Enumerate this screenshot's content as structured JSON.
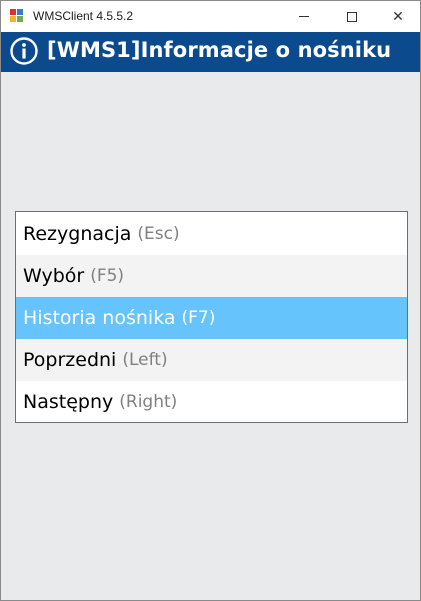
{
  "window": {
    "title": "WMSClient 4.5.5.2",
    "controls": {
      "minimize": "minimize",
      "maximize": "maximize",
      "close": "✕"
    }
  },
  "header": {
    "icon": "info-icon",
    "title": "[WMS1]Informacje o nośniku",
    "background": "#0c4a8e"
  },
  "menu": {
    "items": [
      {
        "label": "Rezygnacja",
        "key": "(Esc)",
        "selected": false
      },
      {
        "label": "Wybór",
        "key": "(F5)",
        "selected": false
      },
      {
        "label": "Historia nośnika",
        "key": "(F7)",
        "selected": true
      },
      {
        "label": "Poprzedni",
        "key": "(Left)",
        "selected": false
      },
      {
        "label": "Następny",
        "key": "(Right)",
        "selected": false
      }
    ],
    "selected_color": "#66c3fb"
  }
}
